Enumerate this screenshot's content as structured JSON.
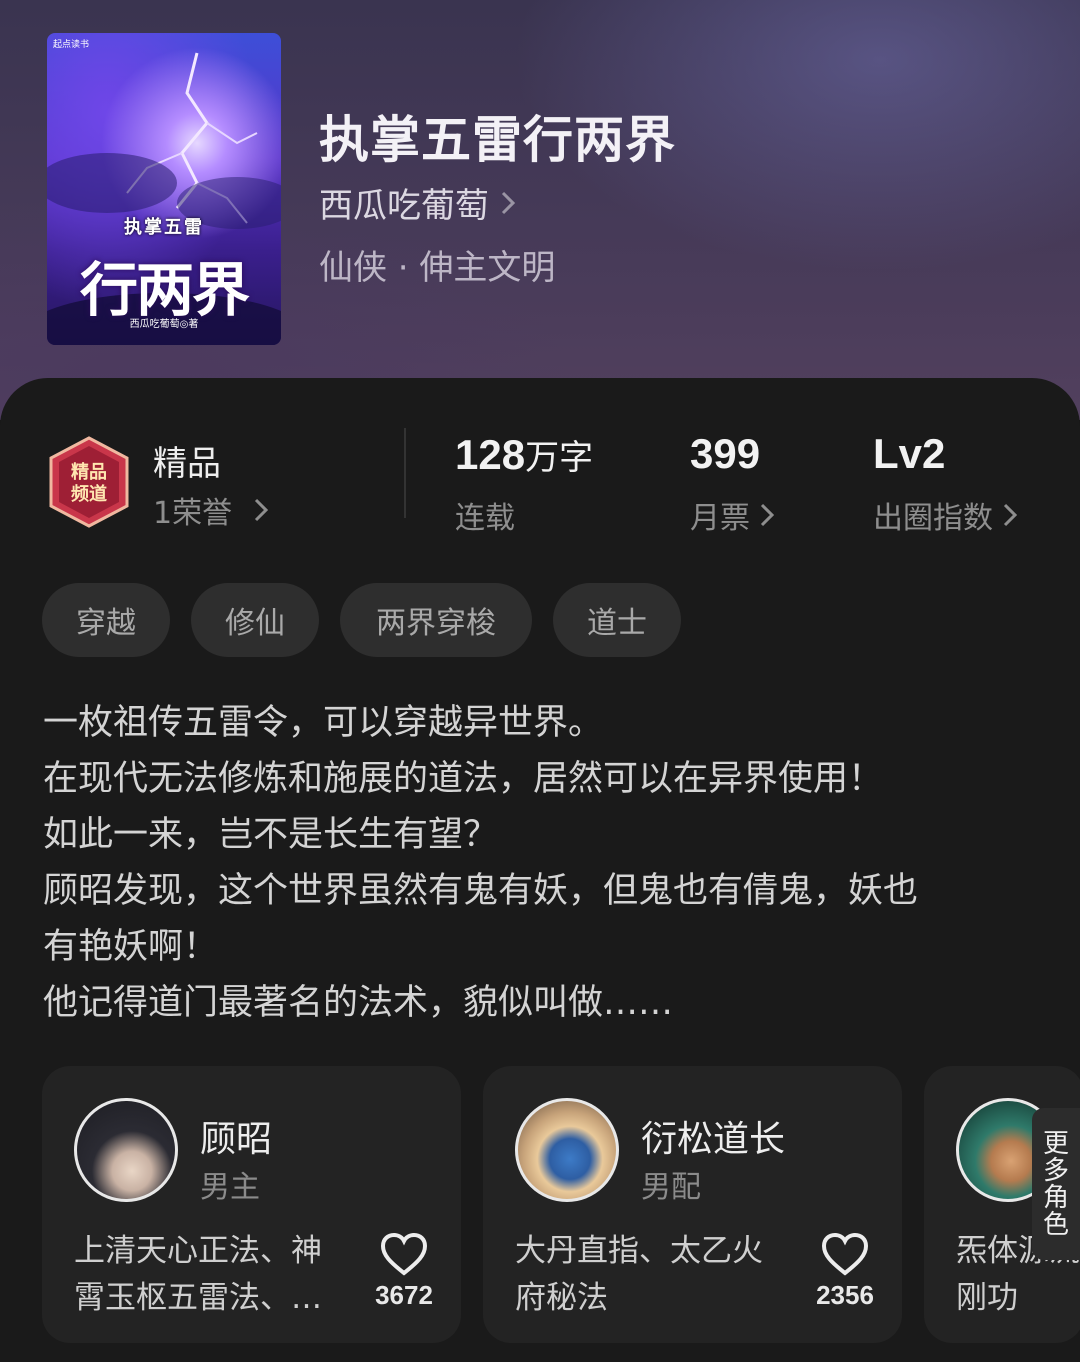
{
  "book": {
    "title": "执掌五雷行两界",
    "author": "西瓜吃葡萄",
    "genre": "仙侠 · 伸主文明",
    "cover": {
      "logo": "起点读书",
      "subtitle": "执掌五雷",
      "title": "行两界",
      "author": "西瓜吃葡萄◎著"
    }
  },
  "stats": {
    "honor": {
      "label": "精品",
      "sub": "1荣誉"
    },
    "words": {
      "value": "128",
      "unit": "万字",
      "label": "连载"
    },
    "tickets": {
      "value": "399",
      "label": "月票"
    },
    "index": {
      "value": "Lv2",
      "label": "出圈指数"
    }
  },
  "tags": [
    "穿越",
    "修仙",
    "两界穿梭",
    "道士"
  ],
  "synopsis": [
    "一枚祖传五雷令，可以穿越异世界。",
    "在现代无法修炼和施展的道法，居然可以在异界使用！",
    "如此一来，岂不是长生有望？",
    "顾昭发现，这个世界虽然有鬼有妖，但鬼也有倩鬼，妖也\n有艳妖啊！",
    "他记得道门最著名的法术，貌似叫做……"
  ],
  "characters": [
    {
      "name": "顾昭",
      "role": "男主",
      "skills": "上清天心正法、神霄玉枢五雷法、…",
      "likes": "3672"
    },
    {
      "name": "衍松道长",
      "role": "男配",
      "skills": "大丹直指、太乙火府秘法",
      "likes": "2356"
    },
    {
      "name": "",
      "role": "",
      "skills": "炁体源流刚功",
      "likes": ""
    }
  ],
  "more_roles": "更多角色",
  "colors": {
    "background": "#141414",
    "card": "#1a1a1a",
    "tag_bg": "#2e2e2e",
    "char_card": "#232323"
  }
}
